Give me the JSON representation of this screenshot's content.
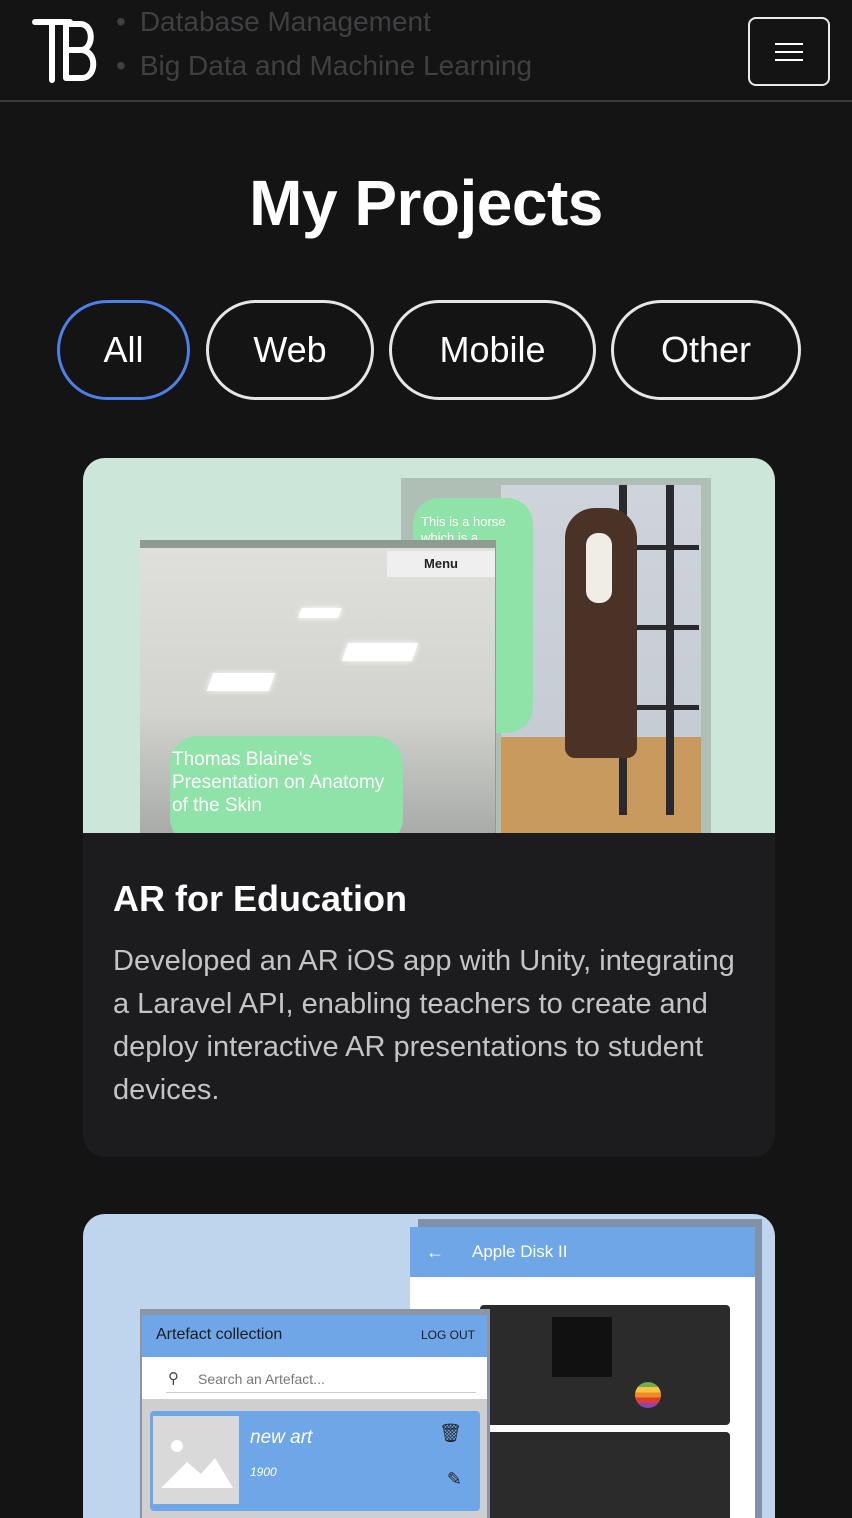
{
  "header": {
    "background_list": [
      "Database Management",
      "Big Data and Machine Learning"
    ],
    "menu_label": ""
  },
  "page": {
    "title": "My Projects"
  },
  "filters": [
    {
      "label": "All",
      "active": true
    },
    {
      "label": "Web",
      "active": false
    },
    {
      "label": "Mobile",
      "active": false
    },
    {
      "label": "Other",
      "active": false
    }
  ],
  "projects": [
    {
      "title": "AR for Education",
      "description": "Developed an AR iOS app with Unity, integrating a Laravel API, enabling teachers to create and deploy interactive AR presentations to student devices.",
      "image": {
        "bubble_right": "This is a horse which is a",
        "menu_tag": "Menu",
        "bubble_left": "Thomas Blaine's Presentation on Anatomy of the Skin"
      }
    },
    {
      "image": {
        "right_title": "Apple Disk II",
        "left_title": "Artefact collection",
        "logout": "LOG OUT",
        "search_placeholder": "Search an Artefact...",
        "item_name": "new art",
        "item_year": "1900"
      }
    }
  ],
  "colors": {
    "background": "#141415",
    "card": "#1c1c1e",
    "active_accent": "#4f7fe8",
    "card1_image_bg": "#cde6da",
    "card2_image_bg": "#bfd5ee"
  },
  "icons": [
    "tb-logo-icon",
    "hamburger-menu-icon",
    "search-icon",
    "back-arrow-icon",
    "trash-icon",
    "pencil-icon",
    "image-placeholder-icon"
  ]
}
